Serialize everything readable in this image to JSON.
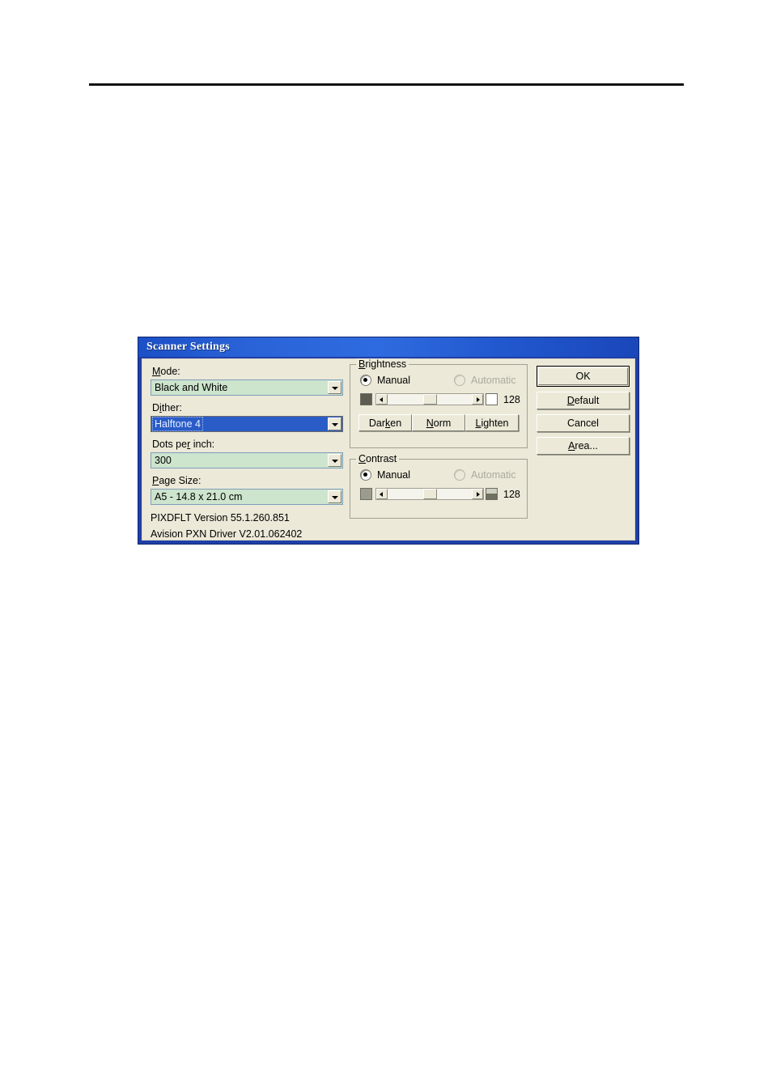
{
  "dialog": {
    "title": "Scanner Settings",
    "left_column": {
      "mode": {
        "label": "Mode:",
        "accelerator": "M",
        "value": "Black and White"
      },
      "dither": {
        "label": "Dither:",
        "accelerator": "i",
        "value": "Halftone 4",
        "selected": true
      },
      "dots_per_inch": {
        "label": "Dots per inch:",
        "accelerator": "r",
        "value": "300"
      },
      "page_size": {
        "label": "Page Size:",
        "accelerator": "P",
        "value": "A5 - 14.8 x 21.0 cm"
      },
      "version_1": "PIXDFLT Version 55.1.260.851",
      "version_2": "Avision PXN Driver V2.01.062402"
    },
    "brightness": {
      "title": "Brightness",
      "accelerator": "B",
      "manual_label": "Manual",
      "automatic_label": "Automatic",
      "manual_selected": true,
      "automatic_disabled": true,
      "value": "128",
      "left_swatch": "dark-square-icon",
      "right_swatch": "white-square-icon",
      "left_arrow": "left-arrow-icon",
      "right_arrow": "right-arrow-icon",
      "darken_label": "Darken",
      "darken_accelerator": "k",
      "norm_label": "Norm",
      "norm_accelerator": "N",
      "lighten_label": "Lighten",
      "lighten_accelerator": "L"
    },
    "contrast": {
      "title": "Contrast",
      "accelerator": "C",
      "manual_label": "Manual",
      "automatic_label": "Automatic",
      "manual_selected": true,
      "automatic_disabled": true,
      "value": "128",
      "left_swatch": "mid-gray-square-icon",
      "right_swatch": "half-filled-square-icon",
      "left_arrow": "left-arrow-icon",
      "right_arrow": "right-arrow-icon"
    },
    "buttons": {
      "ok": "OK",
      "default": "Default",
      "default_accelerator": "D",
      "cancel": "Cancel",
      "area": "Area...",
      "area_accelerator": "A"
    },
    "colors": {
      "titlebar_blue": "#2f6be0",
      "frame_blue": "#1f3fa8",
      "dialog_face": "#ece9d8",
      "combo_green": "#cde4cd",
      "selection_blue": "#2a5cc8",
      "disabled_text": "#aaaa9e"
    }
  }
}
